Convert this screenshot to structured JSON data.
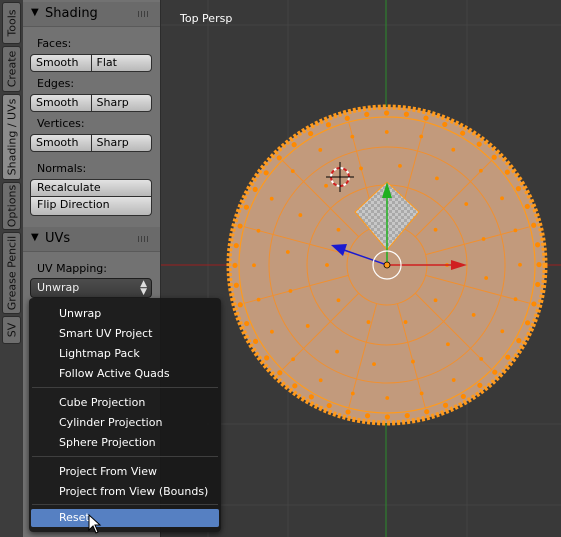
{
  "tabs": [
    "Tools",
    "Create",
    "Shading / UVs",
    "Options",
    "Grease Pencil",
    "SV"
  ],
  "shading": {
    "title": "Shading",
    "faces_label": "Faces:",
    "faces_buttons": [
      "Smooth",
      "Flat"
    ],
    "edges_label": "Edges:",
    "edges_buttons": [
      "Smooth",
      "Sharp"
    ],
    "vertices_label": "Vertices:",
    "vertices_buttons": [
      "Smooth",
      "Sharp"
    ],
    "normals_label": "Normals:",
    "recalculate": "Recalculate",
    "flip_direction": "Flip Direction"
  },
  "uvs": {
    "title": "UVs",
    "mapping_label": "UV Mapping:",
    "mapping_value": "Unwrap"
  },
  "viewport": {
    "title": "Top Persp"
  },
  "menu": {
    "items": [
      "Unwrap",
      "Smart UV Project",
      "Lightmap Pack",
      "Follow Active Quads",
      "Cube Projection",
      "Cylinder Projection",
      "Sphere Projection",
      "Project From View",
      "Project from View (Bounds)",
      "Reset"
    ],
    "highlighted": "Reset"
  },
  "colors": {
    "mesh_fill": "#c29a7c",
    "mesh_edge": "#ff9a1c",
    "x_axis": "#c41f1f",
    "y_axis": "#1da01d",
    "menu_highlight": "#5680c2"
  },
  "icons": {
    "panel_toggle": "triangle-down-icon",
    "panel_grip": "drag-grip-icon",
    "select_arrows": "up-down-arrows-icon",
    "cursor": "mouse-pointer-icon",
    "3d_cursor": "crosshair-icon",
    "manipulator": "transform-manipulator-icon"
  }
}
